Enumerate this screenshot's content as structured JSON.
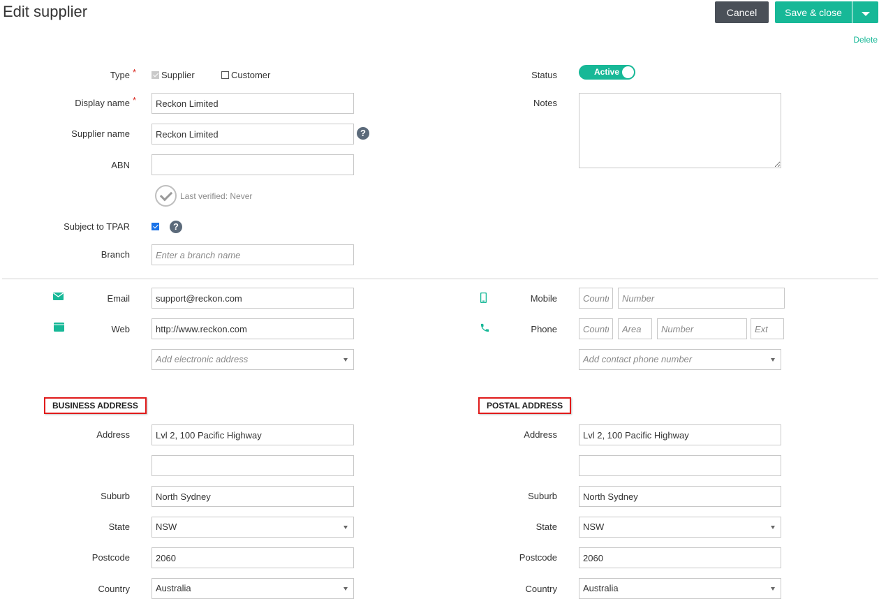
{
  "header": {
    "title": "Edit supplier",
    "cancel_label": "Cancel",
    "save_label": "Save & close",
    "delete_label": "Delete"
  },
  "form": {
    "type_label": "Type",
    "type_options": {
      "supplier": "Supplier",
      "customer": "Customer"
    },
    "display_name_label": "Display name",
    "display_name_value": "Reckon Limited",
    "supplier_name_label": "Supplier name",
    "supplier_name_value": "Reckon Limited",
    "abn_label": "ABN",
    "abn_value": "",
    "last_verified": "Last verified: Never",
    "tpar_label": "Subject to TPAR",
    "branch_label": "Branch",
    "branch_placeholder": "Enter a branch name",
    "status_label": "Status",
    "status_value": "Active",
    "notes_label": "Notes"
  },
  "contact": {
    "email_label": "Email",
    "email_value": "support@reckon.com",
    "web_label": "Web",
    "web_value": "http://www.reckon.com",
    "add_electronic_placeholder": "Add electronic address",
    "mobile_label": "Mobile",
    "phone_label": "Phone",
    "country_placeholder": "Country",
    "number_placeholder": "Number",
    "area_placeholder": "Area",
    "ext_placeholder": "Ext",
    "add_phone_placeholder": "Add contact phone number"
  },
  "business_address": {
    "heading": "BUSINESS ADDRESS",
    "address_label": "Address",
    "address_line1": "Lvl 2, 100 Pacific Highway",
    "address_line2": "",
    "suburb_label": "Suburb",
    "suburb": "North Sydney",
    "state_label": "State",
    "state": "NSW",
    "postcode_label": "Postcode",
    "postcode": "2060",
    "country_label": "Country",
    "country": "Australia"
  },
  "postal_address": {
    "heading": "POSTAL ADDRESS",
    "address_label": "Address",
    "address_line1": "Lvl 2, 100 Pacific Highway",
    "address_line2": "",
    "suburb_label": "Suburb",
    "suburb": "North Sydney",
    "state_label": "State",
    "state": "NSW",
    "postcode_label": "Postcode",
    "postcode": "2060",
    "country_label": "Country",
    "country": "Australia"
  },
  "colors": {
    "accent": "#17b897",
    "cancel": "#4a5058",
    "highlight": "#e01b1b"
  }
}
